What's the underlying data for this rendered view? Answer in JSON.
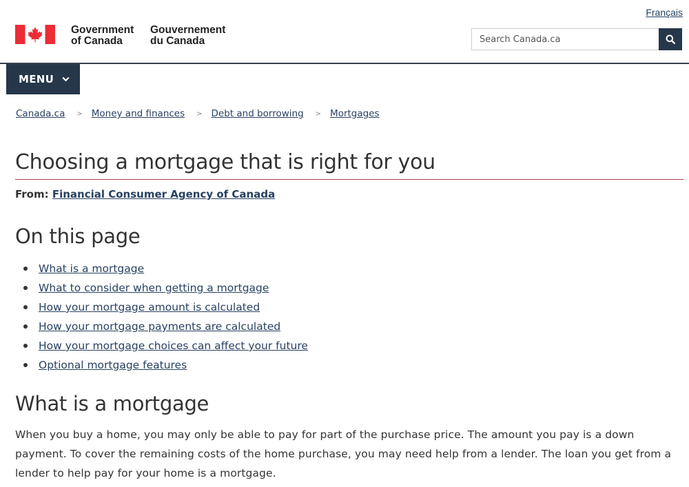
{
  "header": {
    "language_toggle": "Français",
    "brand": {
      "en_line1": "Government",
      "en_line2": "of Canada",
      "fr_line1": "Gouvernement",
      "fr_line2": "du Canada",
      "flag_color": "#eb2d37"
    },
    "search": {
      "placeholder": "Search Canada.ca",
      "button_icon": "search-icon"
    },
    "menu_label": "MENU",
    "menu_icon": "chevron-down-icon"
  },
  "breadcrumb": [
    "Canada.ca",
    "Money and finances",
    "Debt and borrowing",
    "Mortgages"
  ],
  "main": {
    "title": "Choosing a mortgage that is right for you",
    "from_label": "From:",
    "from_link": "Financial Consumer Agency of Canada",
    "toc_heading": "On this page",
    "toc_items": [
      "What is a mortgage",
      "What to consider when getting a mortgage",
      "How your mortgage amount is calculated",
      "How your mortgage payments are calculated",
      "How your mortgage choices can affect your future",
      "Optional mortgage features"
    ],
    "section_heading": "What is a mortgage",
    "section_paragraph": "When you buy a home, you may only be able to pay for part of the purchase price. The amount you pay is a down payment. To cover the remaining costs of the home purchase, you may need help from a lender. The loan you get from a lender to help pay for your home is a mortgage."
  },
  "colors": {
    "navy": "#26374a",
    "link": "#284162",
    "title_rule": "#af3c43",
    "text": "#333333"
  }
}
